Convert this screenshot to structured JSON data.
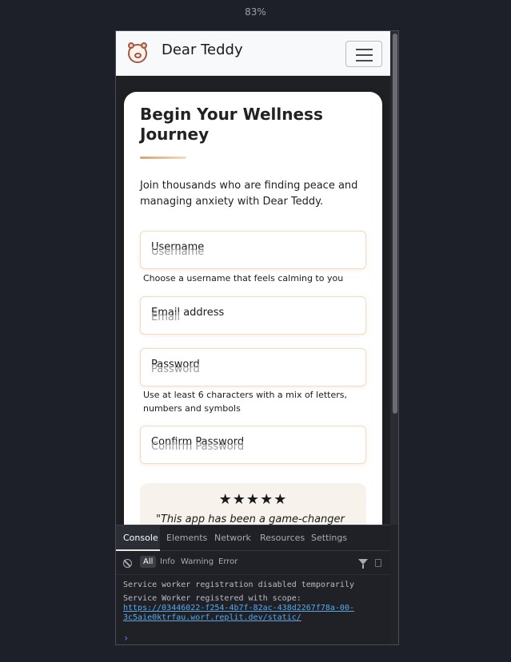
{
  "zoom": "83%",
  "navbar": {
    "brand": "Dear Teddy",
    "logo_icon": "teddy-bear-icon",
    "menu_icon": "hamburger-menu-icon"
  },
  "card": {
    "title": "Begin Your Wellness Journey",
    "subtitle": "Join thousands who are finding peace and managing anxiety with Dear Teddy.",
    "fields": {
      "username": {
        "label": "Username",
        "placeholder": "Username",
        "hint": "Choose a username that feels calming to you"
      },
      "email": {
        "label": "Email address",
        "placeholder": "Email"
      },
      "password": {
        "label": "Password",
        "placeholder": "Password",
        "hint": "Use at least 6 characters with a mix of letters, numbers and symbols"
      },
      "confirm": {
        "label": "Confirm Password",
        "placeholder": "Confirm Password"
      }
    },
    "testimonial": {
      "stars": "★★★★★",
      "rating": 5,
      "quote": "\"This app has been a game-changer"
    }
  },
  "devtools": {
    "tabs": [
      "Console",
      "Elements",
      "Network",
      "Resources",
      "Settings"
    ],
    "active_tab": "Console",
    "filters": [
      "All",
      "Info",
      "Warning",
      "Error"
    ],
    "logs": {
      "line1": "Service worker registration disabled temporarily",
      "line2": "Service Worker registered with scope:",
      "url1": "https://03446022-f254-4b7f-82ac-438d2267f78a-00-",
      "url2": "3c5aie0ktrfau.worf.replit.dev/static/"
    },
    "prompt": "›"
  }
}
